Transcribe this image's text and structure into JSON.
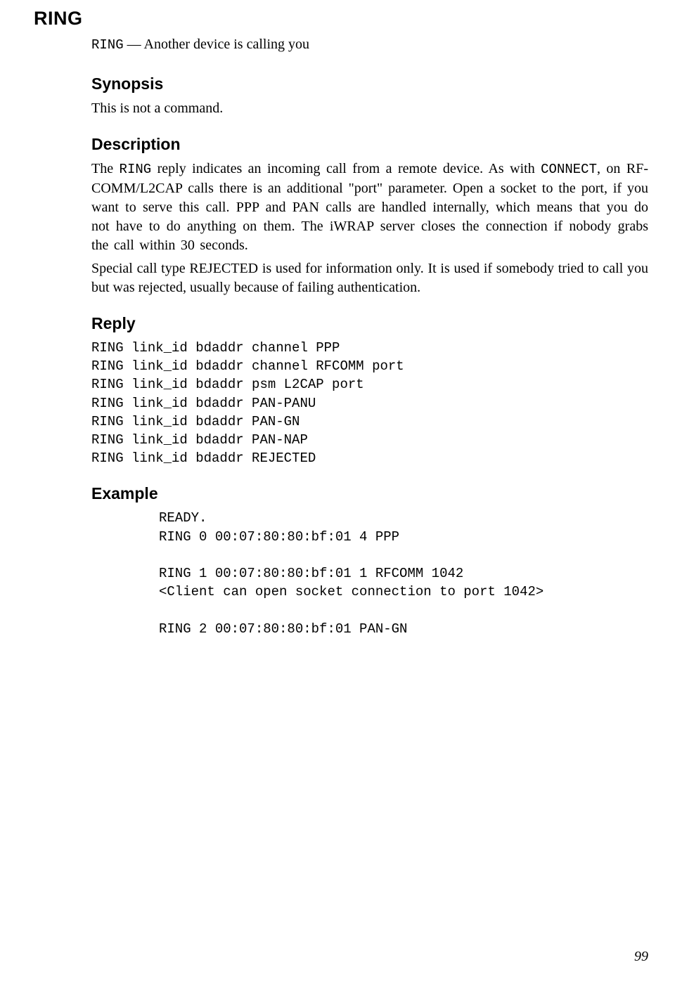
{
  "title": "RING",
  "name_cmd": "RING",
  "name_sep": " — ",
  "name_desc": "Another device is calling you",
  "sections": {
    "synopsis": {
      "heading": "Synopsis",
      "body": "This is not a command."
    },
    "description": {
      "heading": "Description",
      "pre": "The ",
      "cmd1": "RING",
      "mid": " reply indicates an incoming call from a remote device. As with ",
      "cmd2": "CONNECT",
      "post": ", on RF-COMM/L2CAP calls there is an additional \"port\" parameter. Open a socket to the port, if you want to serve this call. PPP and PAN calls are handled internally, which means that you do not have to do anything on them. The iWRAP server closes the connection if nobody grabs the call within 30 seconds.",
      "para2": "Special call type REJECTED is used for information only. It is used if somebody tried to call you but was rejected, usually because of failing authentication."
    },
    "reply": {
      "heading": "Reply",
      "text": "RING link_id bdaddr channel PPP\nRING link_id bdaddr channel RFCOMM port\nRING link_id bdaddr psm L2CAP port\nRING link_id bdaddr PAN-PANU\nRING link_id bdaddr PAN-GN\nRING link_id bdaddr PAN-NAP\nRING link_id bdaddr REJECTED"
    },
    "example": {
      "heading": "Example",
      "text": "READY.\nRING 0 00:07:80:80:bf:01 4 PPP\n\nRING 1 00:07:80:80:bf:01 1 RFCOMM 1042\n<Client can open socket connection to port 1042>\n\nRING 2 00:07:80:80:bf:01 PAN-GN"
    }
  },
  "page_number": "99"
}
